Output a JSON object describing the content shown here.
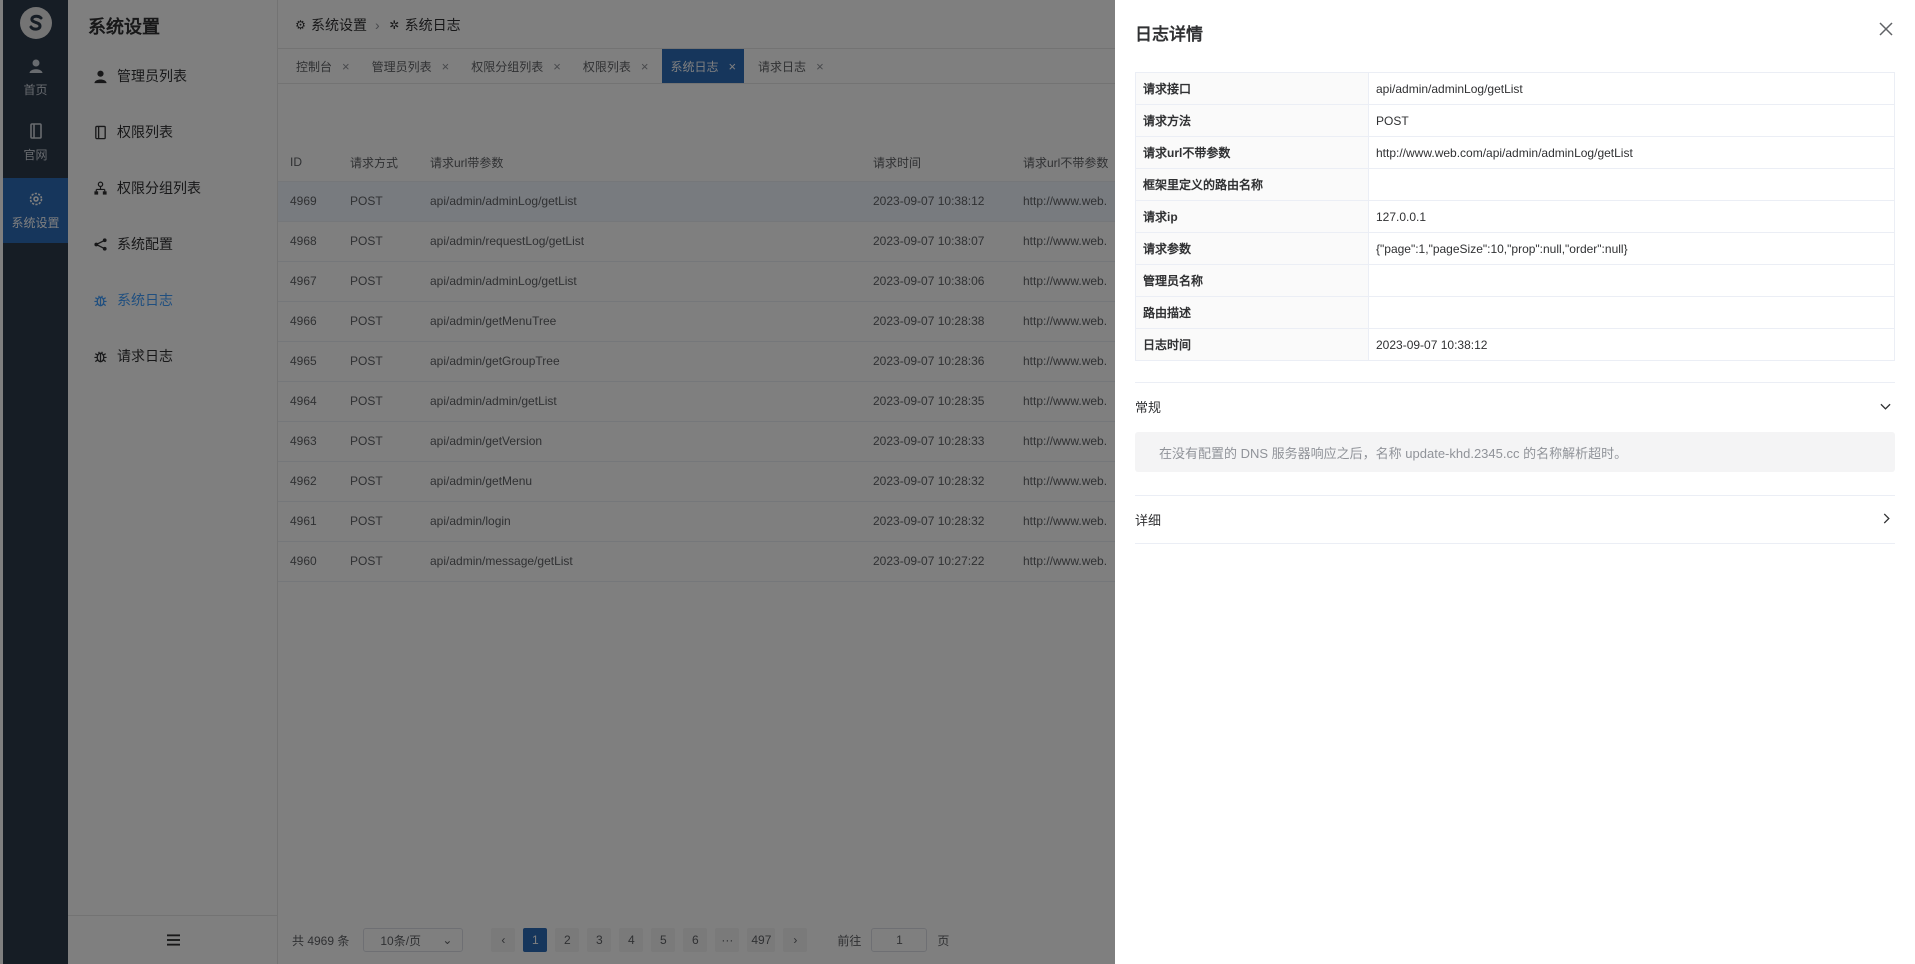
{
  "rail": {
    "items": [
      {
        "label": "首页",
        "icon": "user-icon"
      },
      {
        "label": "官网",
        "icon": "book-icon"
      },
      {
        "label": "系统设置",
        "icon": "gear-icon"
      }
    ]
  },
  "sidebar": {
    "title": "系统设置",
    "items": [
      {
        "label": "管理员列表",
        "icon": "user-icon"
      },
      {
        "label": "权限列表",
        "icon": "book-icon"
      },
      {
        "label": "权限分组列表",
        "icon": "group-icon"
      },
      {
        "label": "系统配置",
        "icon": "share-icon"
      },
      {
        "label": "系统日志",
        "icon": "bug-icon"
      },
      {
        "label": "请求日志",
        "icon": "bug-icon"
      }
    ],
    "footer_icon": "menu-icon"
  },
  "breadcrumb": [
    "系统设置",
    "系统日志"
  ],
  "tabs": [
    {
      "label": "控制台"
    },
    {
      "label": "管理员列表"
    },
    {
      "label": "权限分组列表"
    },
    {
      "label": "权限列表"
    },
    {
      "label": "系统日志",
      "active": true
    },
    {
      "label": "请求日志"
    }
  ],
  "table": {
    "headers": [
      "ID",
      "请求方式",
      "请求url带参数",
      "请求时间",
      "请求url不带参数"
    ],
    "rows": [
      [
        "4969",
        "POST",
        "api/admin/adminLog/getList",
        "2023-09-07 10:38:12",
        "http://www.web."
      ],
      [
        "4968",
        "POST",
        "api/admin/requestLog/getList",
        "2023-09-07 10:38:07",
        "http://www.web."
      ],
      [
        "4967",
        "POST",
        "api/admin/adminLog/getList",
        "2023-09-07 10:38:06",
        "http://www.web."
      ],
      [
        "4966",
        "POST",
        "api/admin/getMenuTree",
        "2023-09-07 10:28:38",
        "http://www.web."
      ],
      [
        "4965",
        "POST",
        "api/admin/getGroupTree",
        "2023-09-07 10:28:36",
        "http://www.web."
      ],
      [
        "4964",
        "POST",
        "api/admin/admin/getList",
        "2023-09-07 10:28:35",
        "http://www.web."
      ],
      [
        "4963",
        "POST",
        "api/admin/getVersion",
        "2023-09-07 10:28:33",
        "http://www.web."
      ],
      [
        "4962",
        "POST",
        "api/admin/getMenu",
        "2023-09-07 10:28:32",
        "http://www.web."
      ],
      [
        "4961",
        "POST",
        "api/admin/login",
        "2023-09-07 10:28:32",
        "http://www.web."
      ],
      [
        "4960",
        "POST",
        "api/admin/message/getList",
        "2023-09-07 10:27:22",
        "http://www.web."
      ]
    ]
  },
  "pagination": {
    "total": "共 4969 条",
    "page_size": "10条/页",
    "pages": [
      "1",
      "2",
      "3",
      "4",
      "5",
      "6",
      "···",
      "497"
    ],
    "current": "1",
    "goto_prefix": "前往",
    "goto_value": "1",
    "goto_suffix": "页"
  },
  "drawer": {
    "title": "日志详情",
    "close_icon": "close-icon",
    "fields": [
      {
        "label": "请求接口",
        "value": "api/admin/adminLog/getList"
      },
      {
        "label": "请求方法",
        "value": "POST"
      },
      {
        "label": "请求url不带参数",
        "value": "http://www.web.com/api/admin/adminLog/getList"
      },
      {
        "label": "框架里定义的路由名称",
        "value": ""
      },
      {
        "label": "请求ip",
        "value": "127.0.0.1"
      },
      {
        "label": "请求参数",
        "value": "{\"page\":1,\"pageSize\":10,\"prop\":null,\"order\":null}"
      },
      {
        "label": "管理员名称",
        "value": ""
      },
      {
        "label": "路由描述",
        "value": ""
      },
      {
        "label": "日志时间",
        "value": "2023-09-07 10:38:12"
      }
    ],
    "sections": [
      {
        "title": "常规",
        "expanded": true,
        "content": "在没有配置的 DNS 服务器响应之后，名称 update-khd.2345.cc 的名称解析超时。"
      },
      {
        "title": "详细",
        "expanded": false
      }
    ]
  },
  "colors": {
    "rail_bg": "#2d3a4b",
    "accent": "#2d6cb8",
    "link": "#409eff"
  }
}
